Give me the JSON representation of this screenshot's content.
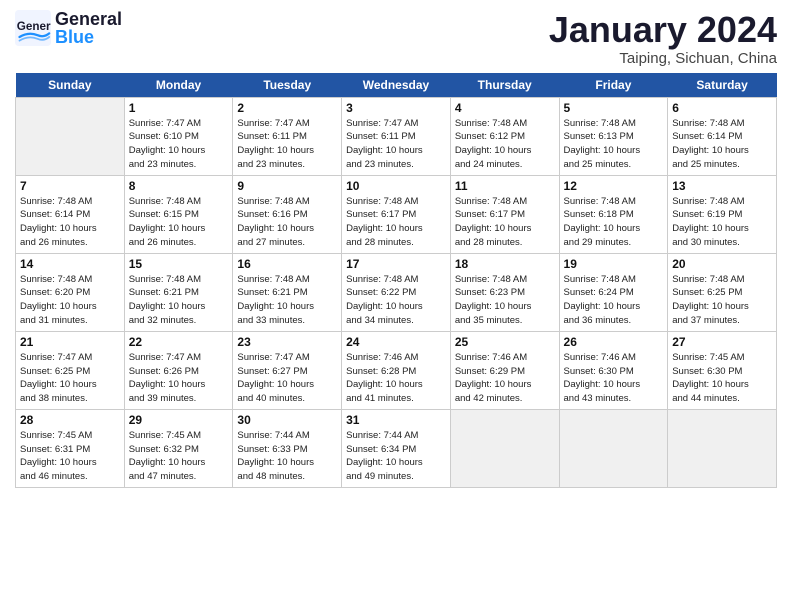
{
  "header": {
    "logo_general": "General",
    "logo_blue": "Blue",
    "month_title": "January 2024",
    "location": "Taiping, Sichuan, China"
  },
  "weekdays": [
    "Sunday",
    "Monday",
    "Tuesday",
    "Wednesday",
    "Thursday",
    "Friday",
    "Saturday"
  ],
  "weeks": [
    [
      {
        "day": "",
        "info": "",
        "shaded": true
      },
      {
        "day": "1",
        "info": "Sunrise: 7:47 AM\nSunset: 6:10 PM\nDaylight: 10 hours\nand 23 minutes.",
        "shaded": false
      },
      {
        "day": "2",
        "info": "Sunrise: 7:47 AM\nSunset: 6:11 PM\nDaylight: 10 hours\nand 23 minutes.",
        "shaded": false
      },
      {
        "day": "3",
        "info": "Sunrise: 7:47 AM\nSunset: 6:11 PM\nDaylight: 10 hours\nand 23 minutes.",
        "shaded": false
      },
      {
        "day": "4",
        "info": "Sunrise: 7:48 AM\nSunset: 6:12 PM\nDaylight: 10 hours\nand 24 minutes.",
        "shaded": false
      },
      {
        "day": "5",
        "info": "Sunrise: 7:48 AM\nSunset: 6:13 PM\nDaylight: 10 hours\nand 25 minutes.",
        "shaded": false
      },
      {
        "day": "6",
        "info": "Sunrise: 7:48 AM\nSunset: 6:14 PM\nDaylight: 10 hours\nand 25 minutes.",
        "shaded": false
      }
    ],
    [
      {
        "day": "7",
        "info": "Sunrise: 7:48 AM\nSunset: 6:14 PM\nDaylight: 10 hours\nand 26 minutes.",
        "shaded": false
      },
      {
        "day": "8",
        "info": "Sunrise: 7:48 AM\nSunset: 6:15 PM\nDaylight: 10 hours\nand 26 minutes.",
        "shaded": false
      },
      {
        "day": "9",
        "info": "Sunrise: 7:48 AM\nSunset: 6:16 PM\nDaylight: 10 hours\nand 27 minutes.",
        "shaded": false
      },
      {
        "day": "10",
        "info": "Sunrise: 7:48 AM\nSunset: 6:17 PM\nDaylight: 10 hours\nand 28 minutes.",
        "shaded": false
      },
      {
        "day": "11",
        "info": "Sunrise: 7:48 AM\nSunset: 6:17 PM\nDaylight: 10 hours\nand 28 minutes.",
        "shaded": false
      },
      {
        "day": "12",
        "info": "Sunrise: 7:48 AM\nSunset: 6:18 PM\nDaylight: 10 hours\nand 29 minutes.",
        "shaded": false
      },
      {
        "day": "13",
        "info": "Sunrise: 7:48 AM\nSunset: 6:19 PM\nDaylight: 10 hours\nand 30 minutes.",
        "shaded": false
      }
    ],
    [
      {
        "day": "14",
        "info": "Sunrise: 7:48 AM\nSunset: 6:20 PM\nDaylight: 10 hours\nand 31 minutes.",
        "shaded": false
      },
      {
        "day": "15",
        "info": "Sunrise: 7:48 AM\nSunset: 6:21 PM\nDaylight: 10 hours\nand 32 minutes.",
        "shaded": false
      },
      {
        "day": "16",
        "info": "Sunrise: 7:48 AM\nSunset: 6:21 PM\nDaylight: 10 hours\nand 33 minutes.",
        "shaded": false
      },
      {
        "day": "17",
        "info": "Sunrise: 7:48 AM\nSunset: 6:22 PM\nDaylight: 10 hours\nand 34 minutes.",
        "shaded": false
      },
      {
        "day": "18",
        "info": "Sunrise: 7:48 AM\nSunset: 6:23 PM\nDaylight: 10 hours\nand 35 minutes.",
        "shaded": false
      },
      {
        "day": "19",
        "info": "Sunrise: 7:48 AM\nSunset: 6:24 PM\nDaylight: 10 hours\nand 36 minutes.",
        "shaded": false
      },
      {
        "day": "20",
        "info": "Sunrise: 7:48 AM\nSunset: 6:25 PM\nDaylight: 10 hours\nand 37 minutes.",
        "shaded": false
      }
    ],
    [
      {
        "day": "21",
        "info": "Sunrise: 7:47 AM\nSunset: 6:25 PM\nDaylight: 10 hours\nand 38 minutes.",
        "shaded": false
      },
      {
        "day": "22",
        "info": "Sunrise: 7:47 AM\nSunset: 6:26 PM\nDaylight: 10 hours\nand 39 minutes.",
        "shaded": false
      },
      {
        "day": "23",
        "info": "Sunrise: 7:47 AM\nSunset: 6:27 PM\nDaylight: 10 hours\nand 40 minutes.",
        "shaded": false
      },
      {
        "day": "24",
        "info": "Sunrise: 7:46 AM\nSunset: 6:28 PM\nDaylight: 10 hours\nand 41 minutes.",
        "shaded": false
      },
      {
        "day": "25",
        "info": "Sunrise: 7:46 AM\nSunset: 6:29 PM\nDaylight: 10 hours\nand 42 minutes.",
        "shaded": false
      },
      {
        "day": "26",
        "info": "Sunrise: 7:46 AM\nSunset: 6:30 PM\nDaylight: 10 hours\nand 43 minutes.",
        "shaded": false
      },
      {
        "day": "27",
        "info": "Sunrise: 7:45 AM\nSunset: 6:30 PM\nDaylight: 10 hours\nand 44 minutes.",
        "shaded": false
      }
    ],
    [
      {
        "day": "28",
        "info": "Sunrise: 7:45 AM\nSunset: 6:31 PM\nDaylight: 10 hours\nand 46 minutes.",
        "shaded": false
      },
      {
        "day": "29",
        "info": "Sunrise: 7:45 AM\nSunset: 6:32 PM\nDaylight: 10 hours\nand 47 minutes.",
        "shaded": false
      },
      {
        "day": "30",
        "info": "Sunrise: 7:44 AM\nSunset: 6:33 PM\nDaylight: 10 hours\nand 48 minutes.",
        "shaded": false
      },
      {
        "day": "31",
        "info": "Sunrise: 7:44 AM\nSunset: 6:34 PM\nDaylight: 10 hours\nand 49 minutes.",
        "shaded": false
      },
      {
        "day": "",
        "info": "",
        "shaded": true
      },
      {
        "day": "",
        "info": "",
        "shaded": true
      },
      {
        "day": "",
        "info": "",
        "shaded": true
      }
    ]
  ]
}
